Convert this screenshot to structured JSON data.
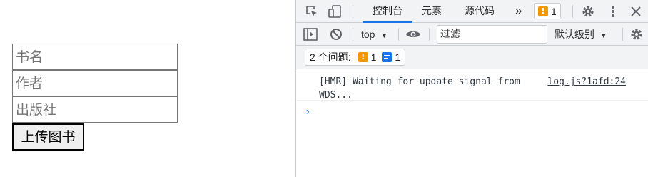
{
  "form": {
    "title_placeholder": "书名",
    "author_placeholder": "作者",
    "publisher_placeholder": "出版社",
    "submit_label": "上传图书"
  },
  "devtools": {
    "tabs": [
      "控制台",
      "元素",
      "源代码"
    ],
    "more_tabs": "»",
    "warning_badge_count": "1",
    "toolbar": {
      "context": "top",
      "filter_placeholder": "过滤",
      "level": "默认级别"
    },
    "issues": {
      "label": "2 个问题:",
      "warning_count": "1",
      "info_count": "1"
    },
    "console": {
      "message": "[HMR] Waiting for update signal from WDS...",
      "source": "log.js?1afd:24",
      "prompt": "›"
    },
    "colors": {
      "accent": "#1a73e8",
      "warning": "#f29900"
    }
  }
}
